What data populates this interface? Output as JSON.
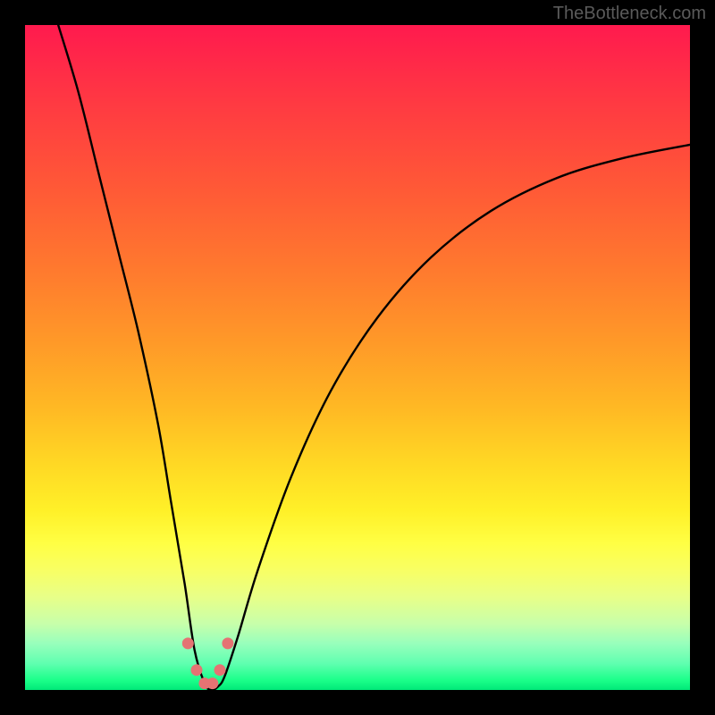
{
  "watermark": "TheBottleneck.com",
  "chart_data": {
    "type": "line",
    "title": "",
    "xlabel": "",
    "ylabel": "",
    "xlim": [
      0,
      100
    ],
    "ylim": [
      0,
      100
    ],
    "note": "No axis ticks or numeric labels are rendered in the image; the plot is a stylized V-shaped curve over a vertical red→green gradient. Values below are estimated pixel-relative positions (0–100) of the black curve.",
    "series": [
      {
        "name": "curve",
        "x": [
          5,
          8,
          11,
          14,
          17,
          20,
          22,
          24,
          25.5,
          27,
          28,
          29,
          30,
          32,
          35,
          40,
          46,
          53,
          61,
          70,
          80,
          90,
          100
        ],
        "y": [
          100,
          90,
          78,
          66,
          54,
          40,
          28,
          16,
          6,
          1,
          0,
          0.5,
          2,
          8,
          18,
          32,
          45,
          56,
          65,
          72,
          77,
          80,
          82
        ]
      }
    ],
    "markers": {
      "name": "valley-dots",
      "x": [
        24.5,
        25.8,
        27.0,
        28.2,
        29.3,
        30.5
      ],
      "y": [
        7,
        3,
        1,
        1,
        3,
        7
      ]
    },
    "colors": {
      "top": "#ff1a4e",
      "mid": "#ffd824",
      "bottom": "#00e878",
      "curve": "#000000",
      "markers": "#e57373",
      "background": "#000000"
    }
  }
}
